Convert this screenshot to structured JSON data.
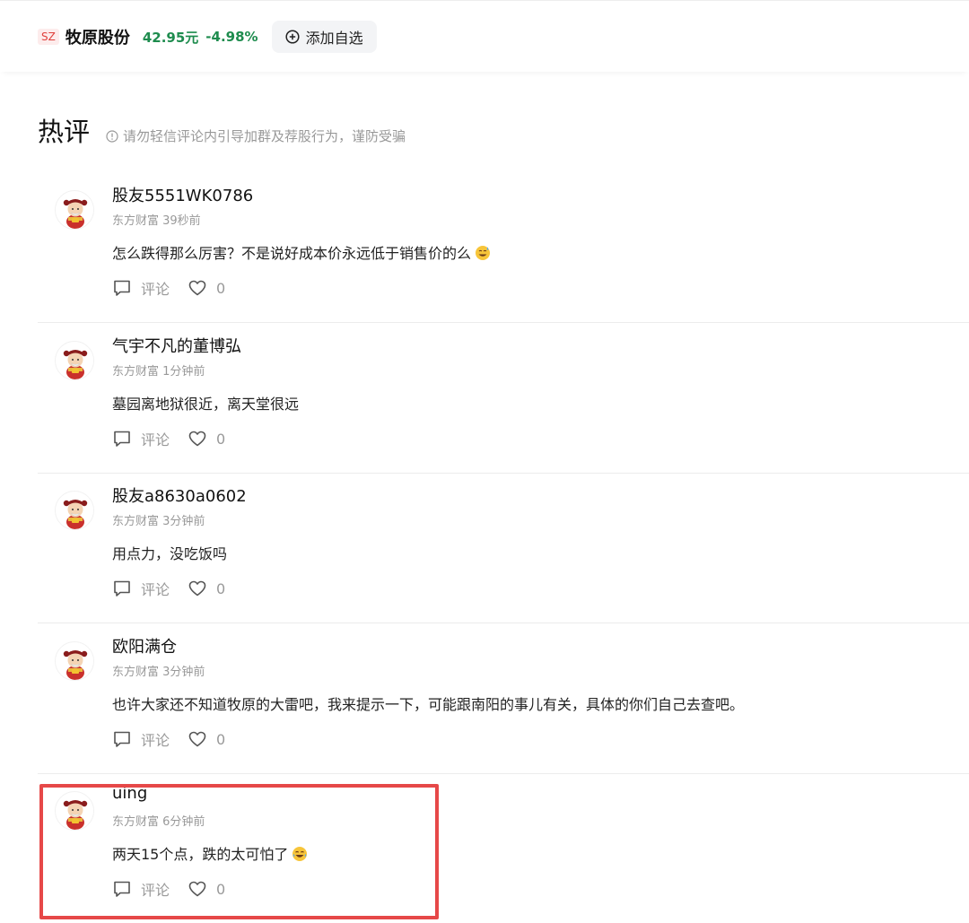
{
  "stock": {
    "market": "SZ",
    "name": "牧原股份",
    "price": "42.95元",
    "change": "-4.98%",
    "add_label": "添加自选",
    "color_down": "#1e8c4e"
  },
  "section": {
    "title": "热评",
    "warning": "请勿轻信评论内引导加群及荐股行为，谨防受骗"
  },
  "comments": [
    {
      "user": "股友5551WK0786",
      "source": "东方财富 39秒前",
      "text": "怎么跌得那么厉害？不是说好成本价永远低于销售价的么",
      "emoji": "sweat-smile",
      "reply_label": "评论",
      "likes": "0"
    },
    {
      "user": "气宇不凡的董博弘",
      "source": "东方财富 1分钟前",
      "text": "墓园离地狱很近，离天堂很远",
      "emoji": "",
      "reply_label": "评论",
      "likes": "0"
    },
    {
      "user": "股友a8630a0602",
      "source": "东方财富 3分钟前",
      "text": "用点力，没吃饭吗",
      "emoji": "",
      "reply_label": "评论",
      "likes": "0"
    },
    {
      "user": "欧阳满仓",
      "source": "东方财富 3分钟前",
      "text": "也许大家还不知道牧原的大雷吧，我来提示一下，可能跟南阳的事儿有关，具体的你们自己去查吧。",
      "emoji": "",
      "reply_label": "评论",
      "likes": "0"
    },
    {
      "user": "uing",
      "source": "东方财富 6分钟前",
      "text": "两天15个点，跌的太可怕了",
      "emoji": "tears-of-joy",
      "reply_label": "评论",
      "likes": "0"
    }
  ],
  "highlight_color": "#e64848"
}
